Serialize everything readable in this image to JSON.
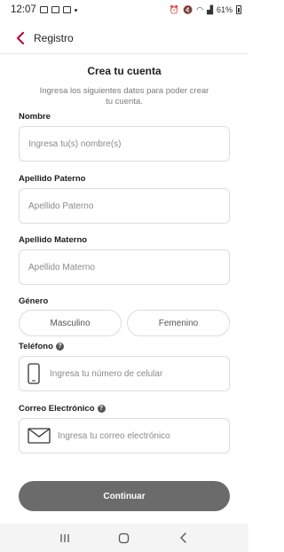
{
  "status_bar": {
    "time": "12:07",
    "battery": "61%"
  },
  "app_bar": {
    "title": "Registro"
  },
  "form": {
    "heading": "Crea tu cuenta",
    "subtext": "Ingresa los siguientes datos para poder crear tu cuenta.",
    "nombre": {
      "label": "Nombre",
      "placeholder": "Ingresa tu(s) nombre(s)"
    },
    "apellido_paterno": {
      "label": "Apellido Paterno",
      "placeholder": "Apellido Paterno"
    },
    "apellido_materno": {
      "label": "Apellido Materno",
      "placeholder": "Apellido Materno"
    },
    "genero": {
      "label": "Género",
      "options": [
        "Masculino",
        "Femenino"
      ]
    },
    "telefono": {
      "label": "Teléfono",
      "placeholder": "Ingresa tu número de celular"
    },
    "correo": {
      "label": "Correo Electrónico",
      "placeholder": "Ingresa tu correo electrónico"
    },
    "continue_label": "Continuar"
  },
  "icons": {
    "back": "chevron-left-icon",
    "help": "question-circle-icon",
    "phone": "phone-icon",
    "email": "envelope-icon"
  },
  "colors": {
    "accent": "#b5123d",
    "button": "#6b6b6b",
    "border": "#dcdcdc"
  }
}
